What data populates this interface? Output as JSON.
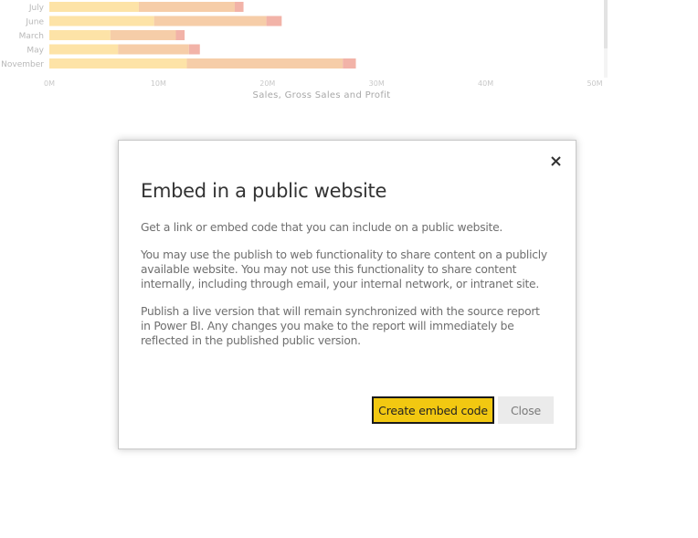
{
  "chart_data": {
    "type": "bar",
    "orientation": "horizontal",
    "stacked": true,
    "categories": [
      "July",
      "June",
      "March",
      "May",
      "November"
    ],
    "series": [
      {
        "name": "Sales",
        "color": "#fde3a7",
        "values": [
          8.2,
          9.6,
          5.6,
          6.3,
          12.6
        ]
      },
      {
        "name": "Gross Sales",
        "color": "#f6cda8",
        "values": [
          8.8,
          10.3,
          6.0,
          6.5,
          14.3
        ]
      },
      {
        "name": "Profit",
        "color": "#f2b3a8",
        "values": [
          0.8,
          1.4,
          0.8,
          1.0,
          1.2
        ]
      }
    ],
    "xlabel": "Sales, Gross Sales and Profit",
    "ylabel": "",
    "xlim": [
      0,
      50
    ],
    "x_ticks": [
      "0M",
      "10M",
      "20M",
      "30M",
      "40M",
      "50M"
    ],
    "units": "M",
    "grid": false,
    "note": "chart is partially scrolled; top rows cut off"
  },
  "dialog": {
    "title": "Embed in a public website",
    "paragraphs": [
      "Get a link or embed code that you can include on a public website.",
      "You may use the publish to web functionality to share content on a publicly available website. You may not use this functionality to share content internally, including through email, your internal network, or intranet site.",
      "Publish a live version that will remain synchronized with the source report in Power BI. Any changes you make to the report will immediately be reflected in the published public version."
    ],
    "close_icon": "close-icon",
    "primary_button": "Create embed code",
    "secondary_button": "Close",
    "accent_color": "#f2c811"
  }
}
